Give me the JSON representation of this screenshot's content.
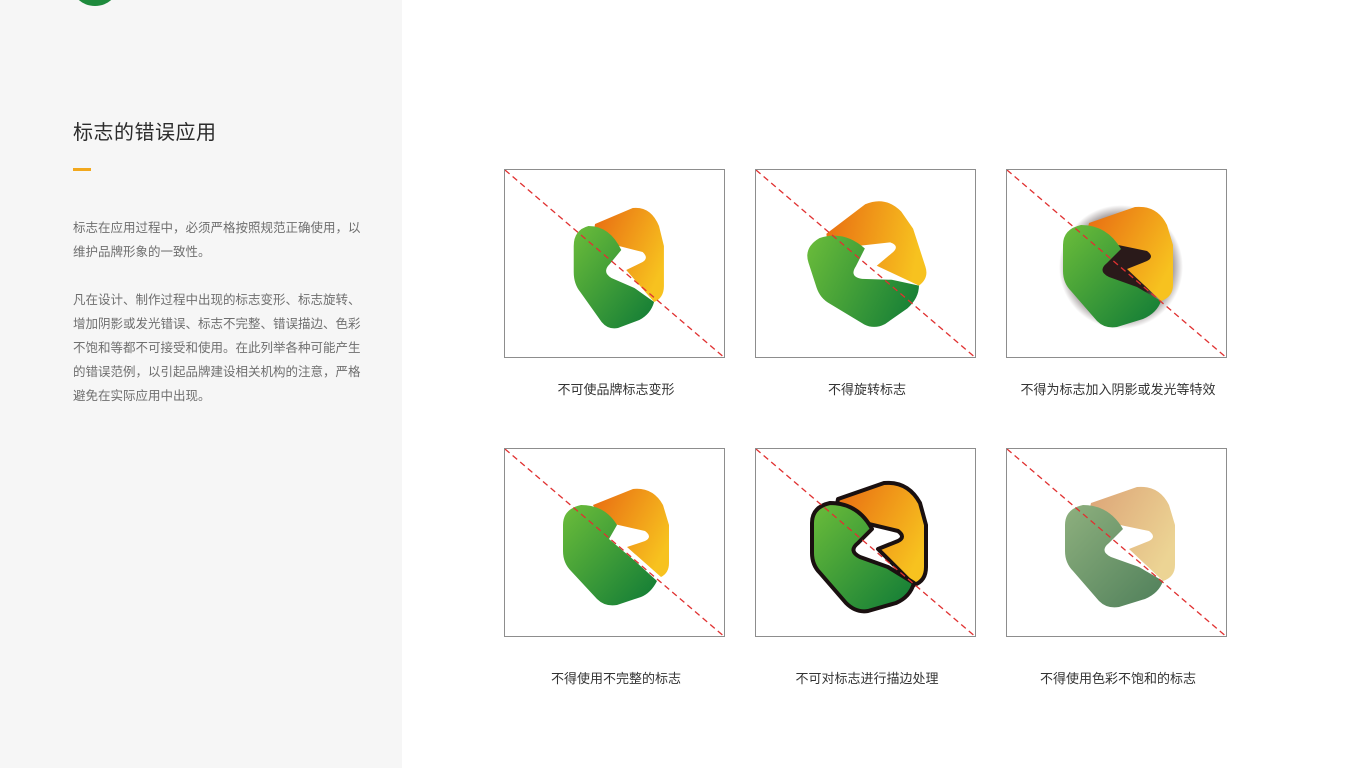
{
  "sidebar": {
    "title": "标志的错误应用",
    "intro_paragraphs": [
      "标志在应用过程中，必须严格按照规范正确使用，以维护品牌形象的一致性。",
      "凡在设计、制作过程中出现的标志变形、标志旋转、增加阴影或发光错误、标志不完整、错误描边、色彩不饱和等都不可接受和使用。在此列举各种可能产生的错误范例，以引起品牌建设相关机构的注意，严格避免在实际应用中出现。"
    ]
  },
  "colors": {
    "sidebar_bg": "#f6f6f6",
    "accent": "#f2a81d",
    "brand_green": "#1e8a3c",
    "brand_orange": "#f08c1e",
    "brand_yellow": "#f7c21f",
    "error_line": "#e03131"
  },
  "examples": [
    {
      "caption": "不可使品牌标志变形"
    },
    {
      "caption": "不得旋转标志"
    },
    {
      "caption": "不得为标志加入阴影或发光等特效"
    },
    {
      "caption": "不得使用不完整的标志"
    },
    {
      "caption": "不可对标志进行描边处理"
    },
    {
      "caption": "不得使用色彩不饱和的标志"
    }
  ]
}
